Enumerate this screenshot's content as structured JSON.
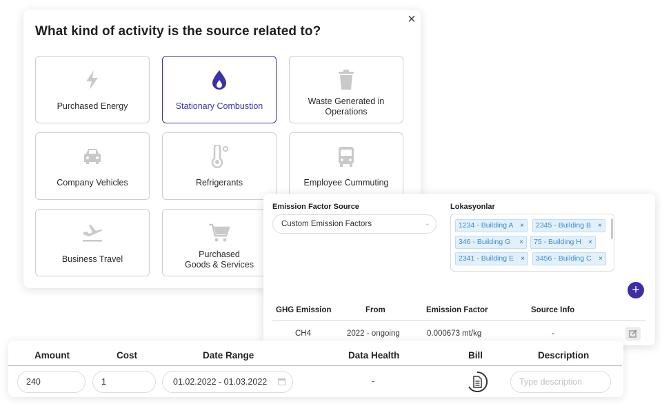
{
  "modal": {
    "title": "What kind of activity is the source related to?",
    "close_label": "×",
    "accent_color": "#3a33a3",
    "categories": [
      {
        "label": "Purchased Energy",
        "icon": "lightning-icon",
        "selected": false
      },
      {
        "label": "Stationary Combustion",
        "icon": "flame-drop-icon",
        "selected": true
      },
      {
        "label_line1": "Waste Generated in",
        "label_line2": "Operations",
        "icon": "trash-icon",
        "selected": false
      },
      {
        "label": "Company Vehicles",
        "icon": "car-icon",
        "selected": false
      },
      {
        "label": "Refrigerants",
        "icon": "thermometer-icon",
        "selected": false
      },
      {
        "label": "Employee Cummuting",
        "icon": "bus-icon",
        "selected": false
      },
      {
        "label": "Business Travel",
        "icon": "airplane-icon",
        "selected": false
      },
      {
        "label_line1": "Purchased",
        "label_line2": "Goods & Services",
        "icon": "cart-icon",
        "selected": false
      }
    ]
  },
  "emission_panel": {
    "source_label": "Emission Factor Source",
    "source_value": "Custom Emission Factors",
    "locations_label": "Lokasyonlar",
    "locations": [
      "1234 - Building A",
      "2345 - Building B",
      "346 - Building G",
      "75 - Building H",
      "2341 - Building E",
      "3456 - Building C"
    ],
    "tag_remove": "×",
    "add_label": "+",
    "table": {
      "headers": [
        "GHG Emission",
        "From",
        "Emission Factor",
        "Source Info"
      ],
      "row": [
        "CH4",
        "2022 - ongoing",
        "0.000673 mt/kg",
        "-"
      ]
    }
  },
  "record_row": {
    "headers": [
      "Amount",
      "Cost",
      "Date Range",
      "Data Health",
      "Bill",
      "Description"
    ],
    "amount": "240",
    "cost": "1",
    "date_range": "01.02.2022 - 01.03.2022",
    "data_health": "-",
    "description_placeholder": "Type description"
  }
}
